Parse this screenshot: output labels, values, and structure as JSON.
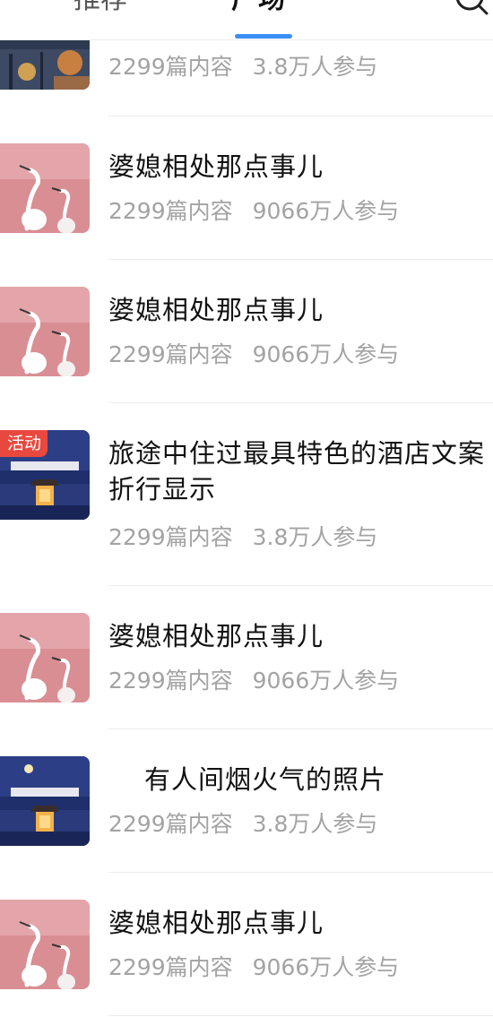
{
  "tabs": {
    "recommend": "推荐",
    "square": "广场"
  },
  "accent_color": "#3a8ff5",
  "badge_color": "#e9483f",
  "items": [
    {
      "title": "",
      "count": "2299篇内容",
      "participants": "3.8万人参与",
      "thumb": "night-street",
      "badge": ""
    },
    {
      "title": "婆媳相处那点事儿",
      "count": "2299篇内容",
      "participants": "9066万人参与",
      "thumb": "pink-cranes",
      "badge": ""
    },
    {
      "title": "婆媳相处那点事儿",
      "count": "2299篇内容",
      "participants": "9066万人参与",
      "thumb": "pink-cranes",
      "badge": ""
    },
    {
      "title": "旅途中住过最具特色的酒店文案折行显示",
      "count": "2299篇内容",
      "participants": "3.8万人参与",
      "thumb": "night-pavilion",
      "badge": "活动"
    },
    {
      "title": "婆媳相处那点事儿",
      "count": "2299篇内容",
      "participants": "9066万人参与",
      "thumb": "pink-cranes",
      "badge": ""
    },
    {
      "title": "有人间烟火气的照片",
      "count": "2299篇内容",
      "participants": "3.8万人参与",
      "thumb": "night-pavilion-moon",
      "badge": ""
    },
    {
      "title": "婆媳相处那点事儿",
      "count": "2299篇内容",
      "participants": "9066万人参与",
      "thumb": "pink-cranes",
      "badge": ""
    }
  ]
}
